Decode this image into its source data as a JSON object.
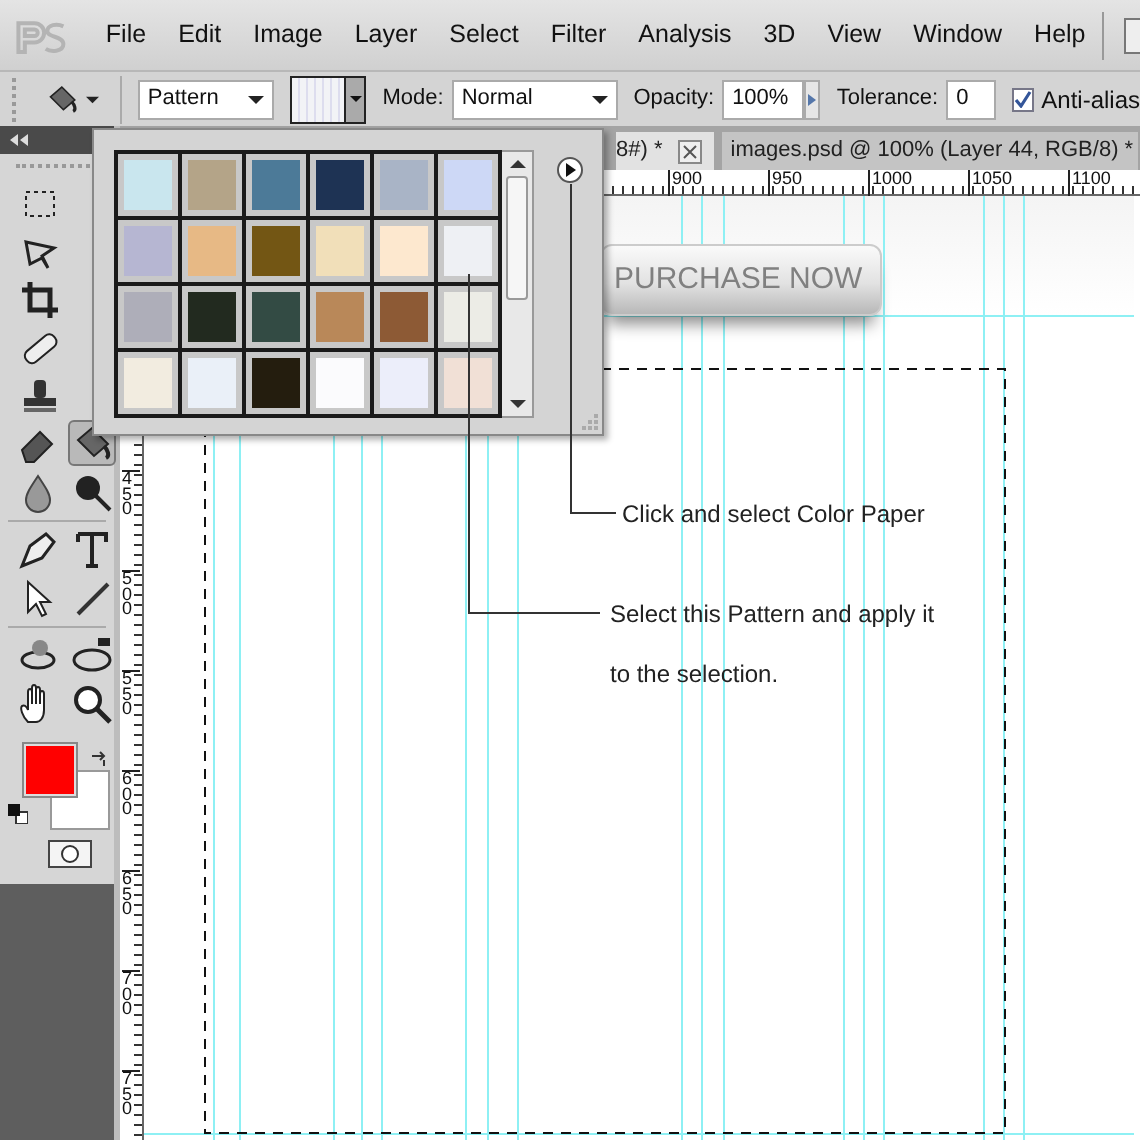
{
  "menu": [
    "File",
    "Edit",
    "Image",
    "Layer",
    "Select",
    "Filter",
    "Analysis",
    "3D",
    "View",
    "Window",
    "Help"
  ],
  "options": {
    "fill_source": "Pattern",
    "mode_label": "Mode:",
    "mode": "Normal",
    "opacity_label": "Opacity:",
    "opacity": "100%",
    "tolerance_label": "Tolerance:",
    "tolerance": "0",
    "anti_alias": {
      "label": "Anti-alias",
      "checked": true
    }
  },
  "tool_groups": [
    [
      [
        {
          "kind": "marquee",
          "selected": false
        }
      ],
      [
        {
          "kind": "lasso",
          "selected": false
        }
      ],
      [
        {
          "kind": "crop",
          "selected": false
        }
      ],
      [
        {
          "kind": "heal",
          "selected": false
        }
      ],
      [
        {
          "kind": "stamp",
          "selected": false
        }
      ],
      [
        {
          "kind": "eraser",
          "selected": false
        },
        {
          "kind": "bucket",
          "selected": true
        }
      ],
      [
        {
          "kind": "drop",
          "selected": false
        },
        {
          "kind": "burn",
          "selected": false
        }
      ]
    ],
    [
      [
        {
          "kind": "pen",
          "selected": false
        },
        {
          "kind": "type",
          "selected": false
        }
      ],
      [
        {
          "kind": "arrow",
          "selected": false
        },
        {
          "kind": "line",
          "selected": false
        }
      ]
    ],
    [
      [
        {
          "kind": "rotate",
          "selected": false
        },
        {
          "kind": "orbit",
          "selected": false
        }
      ],
      [
        {
          "kind": "hand",
          "selected": false
        },
        {
          "kind": "zoom",
          "selected": false
        }
      ]
    ]
  ],
  "tabs": [
    {
      "label": "8#) *",
      "selected": true
    },
    {
      "label": "images.psd @ 100% (Layer 44, RGB/8) *",
      "selected": false
    }
  ],
  "ruler_h": [
    "900",
    "950",
    "1000",
    "1050",
    "1100"
  ],
  "ruler_v": [
    "450",
    "500",
    "550",
    "600",
    "650",
    "700",
    "750"
  ],
  "patterns": [
    {
      "color": "#c9e6ee"
    },
    {
      "color": "#b4a488"
    },
    {
      "color": "#4c7a98"
    },
    {
      "color": "#1e3354"
    },
    {
      "color": "#a9b4c6"
    },
    {
      "color": "#cdd8f6"
    },
    {
      "color": "#b6b6d2"
    },
    {
      "color": "#e7b985"
    },
    {
      "color": "#735614"
    },
    {
      "color": "#f1dfb9"
    },
    {
      "color": "#fde8cf"
    },
    {
      "color": "#eef0f4"
    },
    {
      "color": "#aeaeb9"
    },
    {
      "color": "#222a1f"
    },
    {
      "color": "#334b44"
    },
    {
      "color": "#b98859"
    },
    {
      "color": "#8d5a35"
    },
    {
      "color": "#ecece6"
    },
    {
      "color": "#f2ece0"
    },
    {
      "color": "#eaf0f8"
    },
    {
      "color": "#241d0e"
    },
    {
      "color": "#fbfbfd"
    },
    {
      "color": "#eceefa"
    },
    {
      "color": "#f1e0d6"
    }
  ],
  "canvas": {
    "button": "PURCHASE NOW"
  },
  "annotations": [
    "Click and select Color Paper",
    "Select this Pattern and apply it",
    "to the selection."
  ]
}
